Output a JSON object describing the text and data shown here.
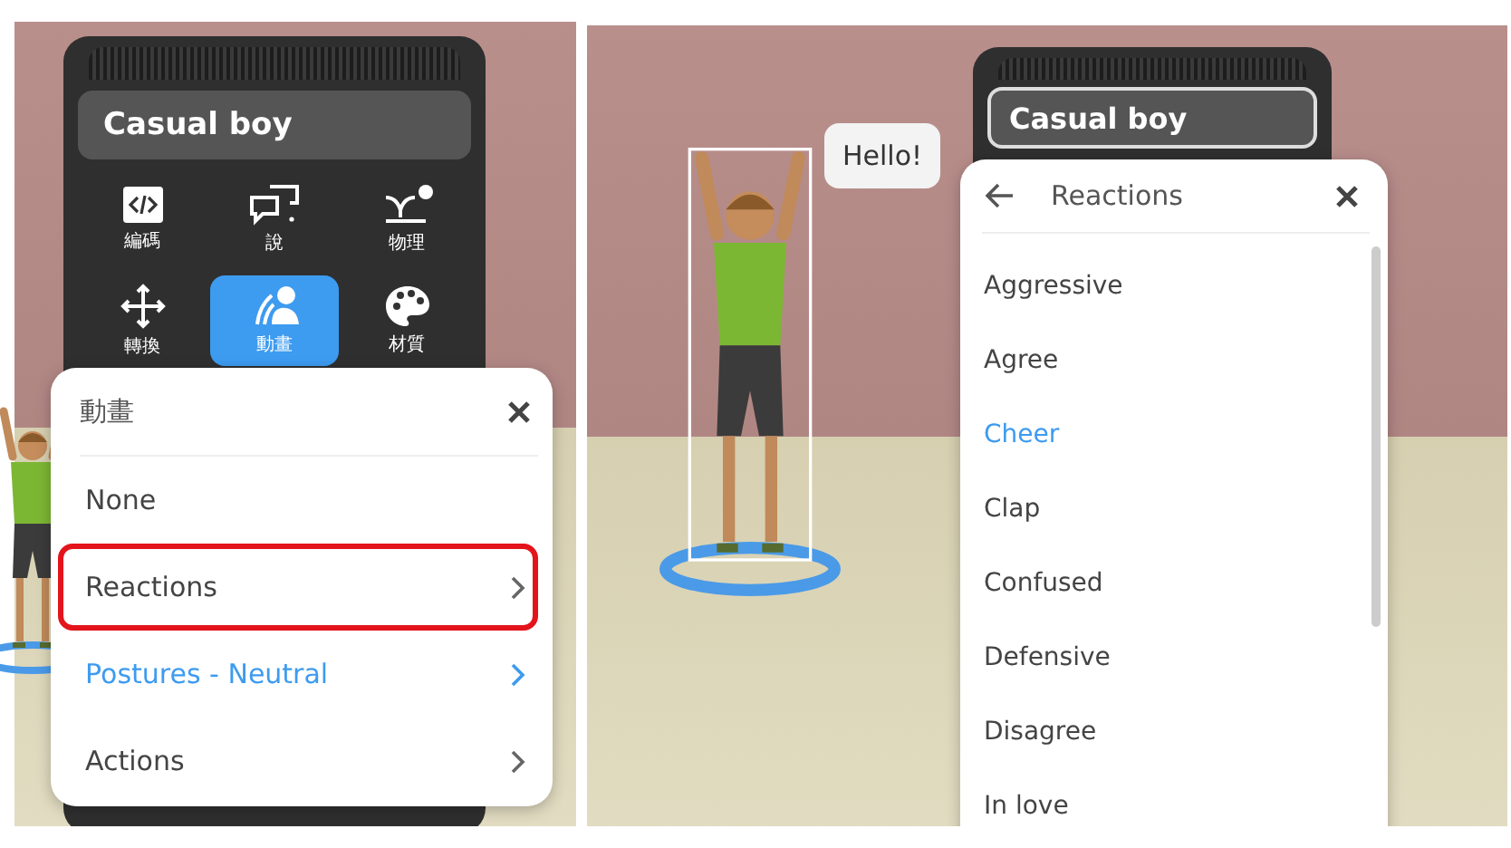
{
  "left_view": {
    "object_panel": {
      "title": "Casual boy",
      "tools": [
        {
          "label": "編碼",
          "kind": "code",
          "selected": false
        },
        {
          "label": "說",
          "kind": "speech",
          "selected": false
        },
        {
          "label": "物理",
          "kind": "physics",
          "selected": false
        },
        {
          "label": "轉換",
          "kind": "move",
          "selected": false
        },
        {
          "label": "動畫",
          "kind": "animation",
          "selected": true
        },
        {
          "label": "材質",
          "kind": "material",
          "selected": false
        }
      ]
    },
    "animation_menu": {
      "title": "動畫",
      "items": [
        {
          "label": "None",
          "selected": false,
          "submenu": false,
          "annotated": false
        },
        {
          "label": "Reactions",
          "selected": false,
          "submenu": true,
          "annotated": true
        },
        {
          "label": "Postures - Neutral",
          "selected": true,
          "submenu": true,
          "annotated": false
        },
        {
          "label": "Actions",
          "selected": false,
          "submenu": true,
          "annotated": false
        }
      ]
    }
  },
  "right_view": {
    "speech_bubble": "Hello!",
    "object_panel": {
      "title": "Casual boy"
    },
    "reactions_menu": {
      "title": "Reactions",
      "items": [
        {
          "label": "Aggressive",
          "selected": false
        },
        {
          "label": "Agree",
          "selected": false
        },
        {
          "label": "Cheer",
          "selected": true
        },
        {
          "label": "Clap",
          "selected": false
        },
        {
          "label": "Confused",
          "selected": false
        },
        {
          "label": "Defensive",
          "selected": false
        },
        {
          "label": "Disagree",
          "selected": false
        },
        {
          "label": "In love",
          "selected": false
        }
      ]
    }
  }
}
